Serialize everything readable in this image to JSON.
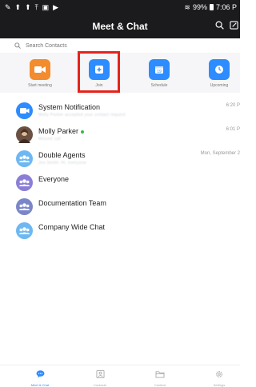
{
  "status": {
    "battery": "99%",
    "time": "7:06 P"
  },
  "header": {
    "title": "Meet & Chat"
  },
  "search": {
    "placeholder": "Search Contacts"
  },
  "actions": [
    {
      "label": "Start meeting",
      "icon": "video-camera-icon",
      "color": "#f28c2e"
    },
    {
      "label": "Join",
      "icon": "plus-icon",
      "color": "#2d8cff"
    },
    {
      "label": "Schedule",
      "icon": "calendar-icon",
      "color": "#2d8cff"
    },
    {
      "label": "Upcoming",
      "icon": "clock-icon",
      "color": "#2d8cff"
    }
  ],
  "highlight_color": "#e5231b",
  "chats": [
    {
      "name": "System Notification",
      "time": "6:20 P",
      "preview": "Molly Parker accepted your contact request",
      "avatar": "video-icon",
      "avatar_color": "#2d8cff"
    },
    {
      "name": "Molly Parker",
      "time": "6:01 P",
      "preview": "Missed call",
      "avatar": "person-photo",
      "avatar_color": "#6b5142",
      "online": true
    },
    {
      "name": "Double Agents",
      "time": "Mon, September 2",
      "preview": "Jon Smith: Hi, everyone",
      "avatar": "group-icon",
      "avatar_color": "#6db8f2"
    },
    {
      "name": "Everyone",
      "time": "",
      "preview": "",
      "avatar": "group-icon",
      "avatar_color": "#8a7fd6"
    },
    {
      "name": "Documentation Team",
      "time": "",
      "preview": "",
      "avatar": "group-icon",
      "avatar_color": "#7b86c8"
    },
    {
      "name": "Company Wide Chat",
      "time": "",
      "preview": "",
      "avatar": "group-icon",
      "avatar_color": "#6db8f2"
    }
  ],
  "tabs": [
    {
      "label": "Meet & Chat",
      "icon": "chat-bubble-icon",
      "active": true
    },
    {
      "label": "Contacts",
      "icon": "contacts-icon",
      "active": false
    },
    {
      "label": "Content",
      "icon": "folder-icon",
      "active": false
    },
    {
      "label": "Settings",
      "icon": "gear-icon",
      "active": false
    }
  ]
}
